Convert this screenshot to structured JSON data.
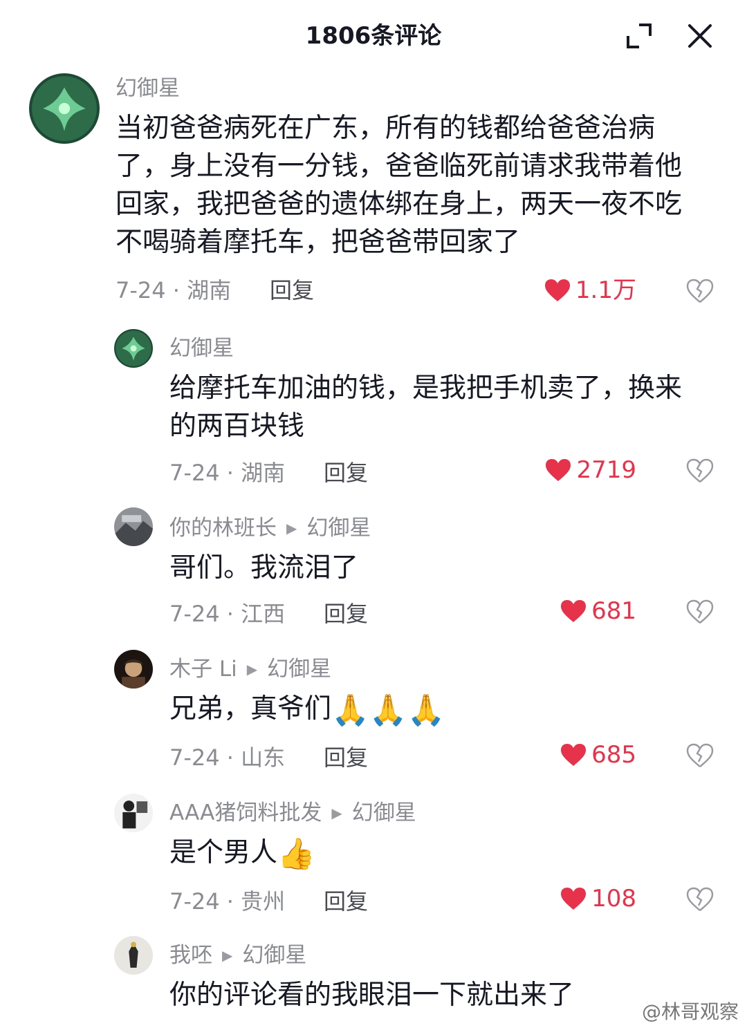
{
  "header": {
    "title": "1806条评论",
    "expand_icon": "expand-icon",
    "close_icon": "close-icon"
  },
  "comments": [
    {
      "user": "幻御星",
      "text": "当初爸爸病死在广东，所有的钱都给爸爸治病了，身上没有一分钱，爸爸临死前请求我带着他回家，我把爸爸的遗体绑在身上，两天一夜不吃不喝骑着摩托车，把爸爸带回家了",
      "meta": "7-24 · 湖南",
      "reply": "回复",
      "likes": "1.1万"
    },
    {
      "user": "幻御星",
      "text": "给摩托车加油的钱，是我把手机卖了，换来的两百块钱",
      "meta": "7-24 · 湖南",
      "reply": "回复",
      "likes": "2719"
    },
    {
      "user": "你的林班长",
      "reply_to": "幻御星",
      "text": "哥们。我流泪了",
      "meta": "7-24 · 江西",
      "reply": "回复",
      "likes": "681"
    },
    {
      "user": "木子 Li",
      "reply_to": "幻御星",
      "text": "兄弟，真爷们",
      "emoji": "🙏🙏🙏",
      "meta": "7-24 · 山东",
      "reply": "回复",
      "likes": "685"
    },
    {
      "user": "AAA猪饲料批发",
      "reply_to": "幻御星",
      "text": "是个男人",
      "emoji": "👍",
      "meta": "7-24 · 贵州",
      "reply": "回复",
      "likes": "108"
    },
    {
      "user": "我呸",
      "reply_to": "幻御星",
      "text": "你的评论看的我眼泪一下就出来了"
    }
  ],
  "watermark": "@林哥观察",
  "colors": {
    "like": "#e6324b",
    "muted": "#8a8b91",
    "text": "#161823"
  }
}
